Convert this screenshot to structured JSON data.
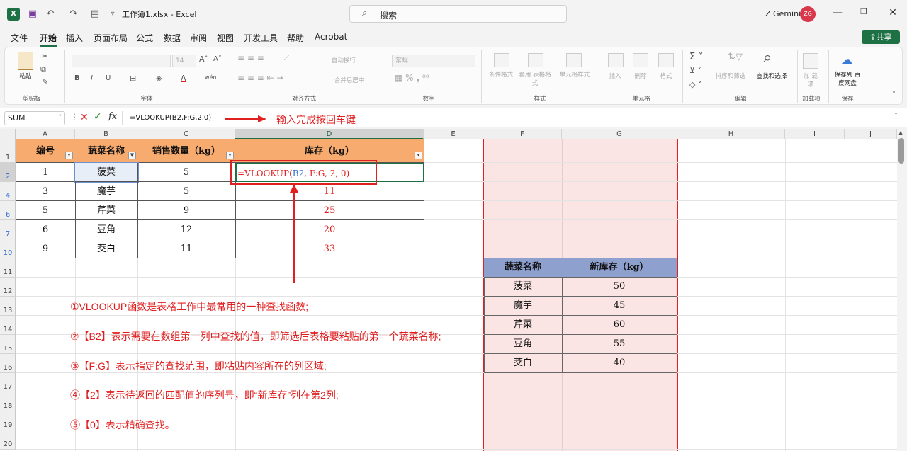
{
  "titlebar": {
    "doc_title": "工作簿1.xlsx - Excel",
    "search_placeholder": "搜索",
    "user_name": "Z Gemini",
    "avatar_initials": "ZG"
  },
  "menu_tabs": [
    "文件",
    "开始",
    "插入",
    "页面布局",
    "公式",
    "数据",
    "审阅",
    "视图",
    "开发工具",
    "帮助",
    "Acrobat"
  ],
  "active_tab": "开始",
  "share_label": "共享",
  "ribbon": {
    "groups": [
      "剪贴板",
      "字体",
      "对齐方式",
      "数字",
      "样式",
      "单元格",
      "编辑",
      "加载项",
      "保存"
    ],
    "clipboard_paste": "粘贴",
    "font_size": "14",
    "wrap_text": "自动换行",
    "merge_center": "合并后居中",
    "number_format": "常规",
    "conditional_format": "条件格式",
    "table_format": "套用 表格格式",
    "cell_styles": "单元格样式",
    "insert": "插入",
    "delete": "删除",
    "format": "格式",
    "sort_filter": "排序和筛选",
    "find_select": "查找和选择",
    "addins": "加 载项",
    "save_baidu": "保存到 百度网盘"
  },
  "formula_bar": {
    "name_box": "SUM",
    "formula": "=VLOOKUP(B2,F:G,2,0)",
    "annotation": "输入完成按回车键"
  },
  "sheet": {
    "columns": [
      "A",
      "B",
      "C",
      "D",
      "E",
      "F",
      "G",
      "H",
      "I",
      "J"
    ],
    "visible_rows": [
      "1",
      "2",
      "4",
      "6",
      "7",
      "10",
      "11",
      "12",
      "13",
      "14",
      "15",
      "16",
      "17",
      "18",
      "19",
      "20"
    ],
    "table1": {
      "headers": [
        "编号",
        "蔬菜名称",
        "销售数量（kg）",
        "库存（kg）"
      ],
      "rows": [
        {
          "id": "1",
          "name": "菠菜",
          "qty": "5",
          "stock": "=VLOOKUP(B2, F:G, 2, 0)"
        },
        {
          "id": "3",
          "name": "魔芋",
          "qty": "5",
          "stock": "11"
        },
        {
          "id": "5",
          "name": "芹菜",
          "qty": "9",
          "stock": "25"
        },
        {
          "id": "6",
          "name": "豆角",
          "qty": "12",
          "stock": "20"
        },
        {
          "id": "9",
          "name": "茭白",
          "qty": "11",
          "stock": "33"
        }
      ]
    },
    "editing_formula": {
      "fn": "=VLOOKUP(",
      "arg1": "B2",
      "rest": ", F:G, 2, 0)"
    },
    "table2": {
      "headers": [
        "蔬菜名称",
        "新库存（kg）"
      ],
      "rows": [
        {
          "name": "菠菜",
          "stock": "50"
        },
        {
          "name": "魔芋",
          "stock": "45"
        },
        {
          "name": "芹菜",
          "stock": "60"
        },
        {
          "name": "豆角",
          "stock": "55"
        },
        {
          "name": "茭白",
          "stock": "40"
        }
      ]
    },
    "notes": [
      "①VLOOKUP函数是表格工作中最常用的一种查找函数;",
      "②【B2】表示需要在数组第一列中查找的值，即筛选后表格要粘贴的第一个蔬菜名称;",
      "③【F:G】表示指定的查找范围，即粘贴内容所在的列区域;",
      "④【2】表示待返回的匹配值的序列号，即“新库存”列在第2列;",
      "⑤【0】表示精确查找。"
    ]
  },
  "colors": {
    "accent": "#1e7145",
    "header_orange": "#f7ab6f",
    "header_blue": "#8ea0ce",
    "pink_fill": "#fbe4e4",
    "annotation_red": "#e02020"
  }
}
